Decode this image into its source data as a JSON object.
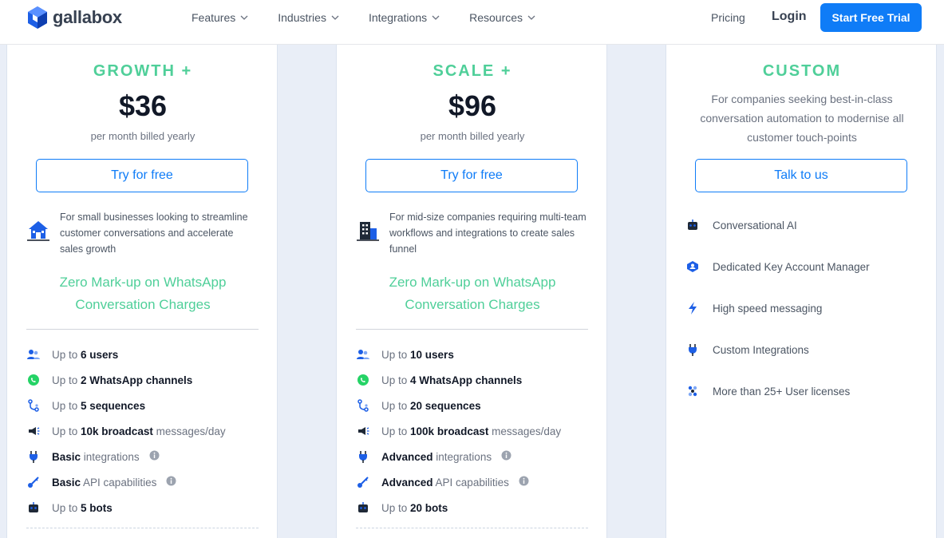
{
  "nav": {
    "logo_text": "gallabox",
    "menu": [
      "Features",
      "Industries",
      "Integrations",
      "Resources"
    ],
    "pricing": "Pricing",
    "login": "Login",
    "cta": "Start Free Trial",
    "accent_color": "#0f7cf7"
  },
  "plans": [
    {
      "name": "GROWTH +",
      "price": "$36",
      "billing": "per month billed yearly",
      "cta": "Try for free",
      "segment": "For small businesses looking to streamline customer conversations and accelerate sales growth",
      "zero_markup": [
        "Zero Mark-up on WhatsApp",
        "Conversation Charges"
      ],
      "features": [
        {
          "pre": "Up to ",
          "bold": "6 users",
          "post": ""
        },
        {
          "pre": "Up to ",
          "bold": "2 WhatsApp channels",
          "post": ""
        },
        {
          "pre": "Up to ",
          "bold": "5 sequences",
          "post": ""
        },
        {
          "pre": "Up to ",
          "bold": "10k broadcast",
          "post": " messages/day"
        },
        {
          "pre": "",
          "bold": "Basic",
          "post": " integrations"
        },
        {
          "pre": "",
          "bold": "Basic",
          "post": " API capabilities"
        },
        {
          "pre": "Up to ",
          "bold": "5 bots",
          "post": ""
        }
      ]
    },
    {
      "name": "SCALE +",
      "price": "$96",
      "billing": "per month billed yearly",
      "cta": "Try for free",
      "segment": "For mid-size companies requiring multi-team workflows and integrations to create sales funnel",
      "zero_markup": [
        "Zero Mark-up on WhatsApp",
        "Conversation Charges"
      ],
      "features": [
        {
          "pre": "Up to ",
          "bold": "10 users",
          "post": ""
        },
        {
          "pre": "Up to ",
          "bold": "4 WhatsApp channels",
          "post": ""
        },
        {
          "pre": "Up to ",
          "bold": "20 sequences",
          "post": ""
        },
        {
          "pre": "Up to ",
          "bold": "100k broadcast",
          "post": " messages/day"
        },
        {
          "pre": "",
          "bold": "Advanced",
          "post": " integrations"
        },
        {
          "pre": "",
          "bold": "Advanced",
          "post": " API capabilities"
        },
        {
          "pre": "Up to ",
          "bold": "20 bots",
          "post": ""
        }
      ]
    },
    {
      "name": "CUSTOM",
      "description": "For companies seeking best-in-class conversation automation to modernise all customer touch-points",
      "cta": "Talk to us",
      "features": [
        "Conversational AI",
        "Dedicated Key Account Manager",
        "High speed messaging",
        "Custom Integrations",
        "More than 25+ User licenses"
      ]
    }
  ],
  "colors": {
    "plan_green": "#4fcf99",
    "cta_blue": "#0f7cf7"
  },
  "icons": {
    "features": [
      "users-icon",
      "whatsapp-icon",
      "sequences-icon",
      "broadcast-icon",
      "plug-icon",
      "api-key-icon",
      "bot-icon"
    ],
    "custom": [
      "bot-icon",
      "account-manager-icon",
      "lightning-icon",
      "plug-icon",
      "user-licenses-icon"
    ]
  }
}
